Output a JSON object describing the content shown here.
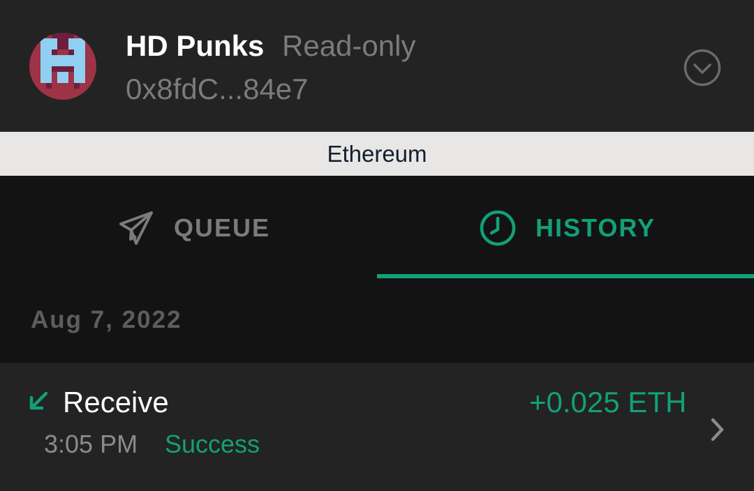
{
  "header": {
    "safe_name": "HD Punks",
    "access_label": "Read-only",
    "address": "0x8fdC...84e7",
    "avatar_icon": "punk-avatar-icon",
    "dropdown_icon": "chevron-down-circle-icon"
  },
  "network": {
    "name": "Ethereum"
  },
  "tabs": [
    {
      "label": "QUEUE",
      "icon": "rocket-icon",
      "active": false
    },
    {
      "label": "HISTORY",
      "icon": "clock-icon",
      "active": true
    }
  ],
  "history": {
    "date": "Aug 7, 2022",
    "transactions": [
      {
        "type": "Receive",
        "direction_icon": "arrow-down-left-icon",
        "amount": "+0.025 ETH",
        "time": "3:05 PM",
        "status": "Success"
      }
    ]
  },
  "colors": {
    "accent": "#12a078",
    "background": "#121312",
    "surface": "#222322",
    "network_bar": "#e8e7e6",
    "muted_text": "#7a7b7a"
  }
}
